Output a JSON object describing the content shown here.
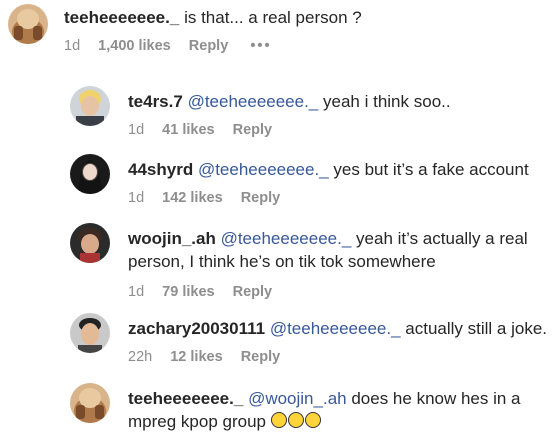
{
  "comments": [
    {
      "username": "teeheeeeeee._",
      "mention": "",
      "text": "is that... a real person ?",
      "time": "1d",
      "likes": "1,400 likes",
      "reply": "Reply",
      "more": "•••"
    },
    {
      "username": "te4rs.7",
      "mention": "@teeheeeeeee._",
      "text": "yeah i think soo..",
      "time": "1d",
      "likes": "41 likes",
      "reply": "Reply"
    },
    {
      "username": "44shyrd",
      "mention": "@teeheeeeeee._",
      "text": "yes but it’s a fake account",
      "time": "1d",
      "likes": "142 likes",
      "reply": "Reply"
    },
    {
      "username": "woojin_.ah",
      "mention": "@teeheeeeeee._",
      "text": "yeah it’s actually a real person, I think he’s on tik tok somewhere",
      "time": "1d",
      "likes": "79 likes",
      "reply": "Reply"
    },
    {
      "username": "zachary20030111",
      "mention": "@teeheeeeeee._",
      "text": "actually still a joke.",
      "time": "22h",
      "likes": "12 likes",
      "reply": "Reply"
    },
    {
      "username": "teeheeeeeee._",
      "mention": "@woojin_.ah",
      "text": "does he know hes in a mpreg kpop group",
      "emoji_icons": [
        "crying-laughing-emoji",
        "crying-laughing-emoji",
        "crying-laughing-emoji"
      ]
    }
  ],
  "colors": {
    "mention": "#385898",
    "text": "#262626",
    "meta": "#8e8e8e"
  }
}
